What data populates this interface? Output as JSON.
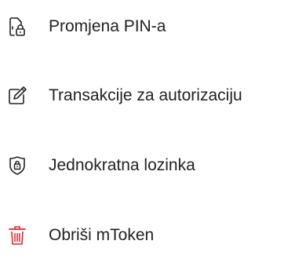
{
  "menu": {
    "items": [
      {
        "label": "Promjena PIN-a",
        "icon": "pin-change-icon"
      },
      {
        "label": "Transakcije za autorizaciju",
        "icon": "authorize-pen-icon"
      },
      {
        "label": "Jednokratna lozinka",
        "icon": "one-time-password-shield-icon"
      },
      {
        "label": "Obriši mToken",
        "icon": "trash-icon",
        "color": "#e0202a"
      }
    ]
  },
  "colors": {
    "text": "#222222",
    "icon": "#222222",
    "danger": "#e0202a"
  }
}
